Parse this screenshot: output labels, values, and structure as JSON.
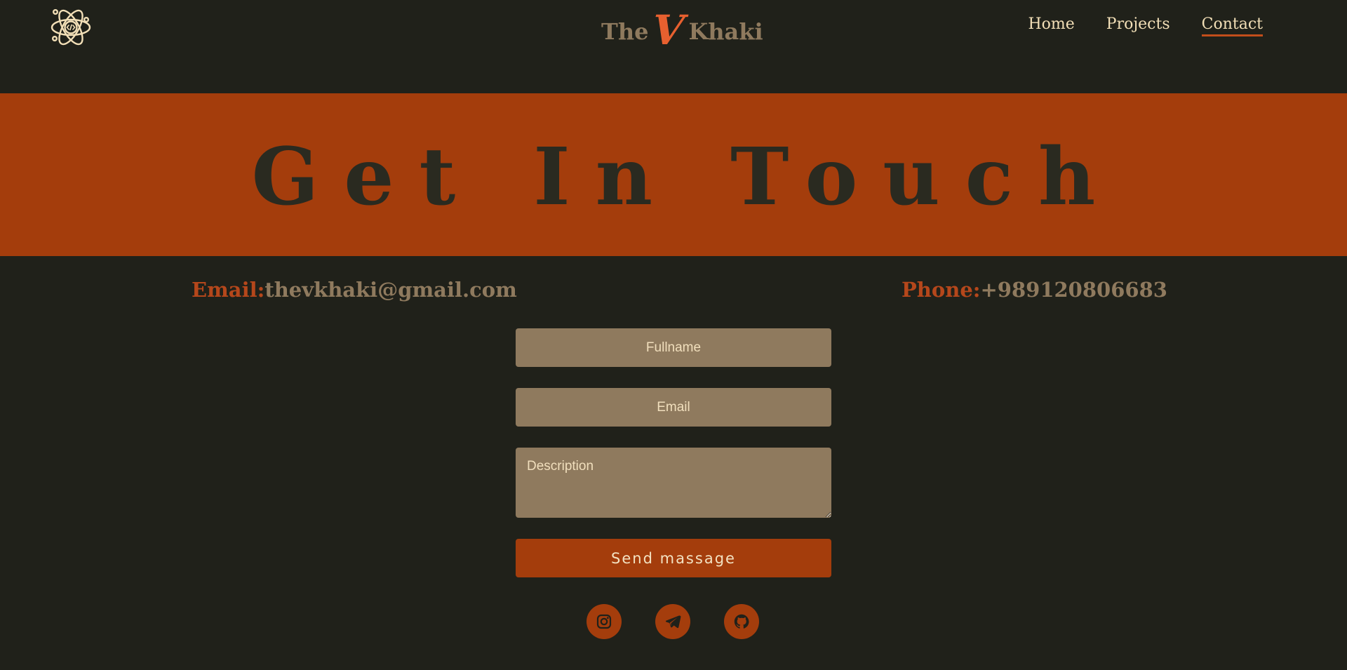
{
  "header": {
    "brand": {
      "the": "The",
      "v": "V",
      "khaki": "Khaki"
    },
    "nav": [
      {
        "label": "Home",
        "active": false
      },
      {
        "label": "Projects",
        "active": false
      },
      {
        "label": "Contact",
        "active": true
      }
    ],
    "logo_icon": "atom-code-icon"
  },
  "banner": {
    "title": "Get In Touch"
  },
  "contact": {
    "email_label": "Email:",
    "email_value": "thevkhaki@gmail.com",
    "phone_label": "Phone:",
    "phone_value": "+989120806683"
  },
  "form": {
    "fullname_placeholder": "Fullname",
    "email_placeholder": "Email",
    "description_placeholder": "Description",
    "submit_label": "Send massage"
  },
  "socials": [
    {
      "icon": "instagram-icon"
    },
    {
      "icon": "telegram-icon"
    },
    {
      "icon": "github-icon"
    }
  ],
  "colors": {
    "background": "#20211a",
    "accent": "#a43d0c",
    "khaki": "#8f7a5e",
    "cream": "#f2dfb7",
    "brand_v": "#e7602f"
  }
}
